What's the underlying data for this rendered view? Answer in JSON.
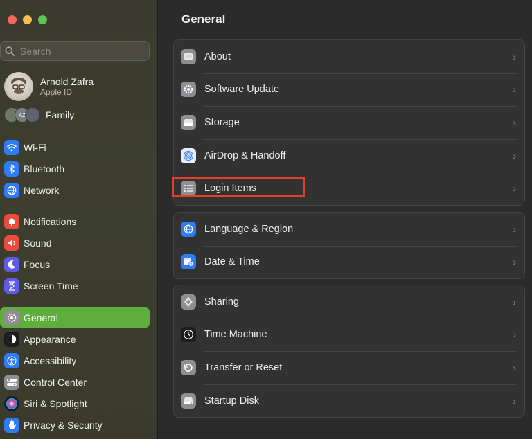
{
  "sidebar": {
    "search_placeholder": "Search",
    "profile": {
      "name": "Arnold Zafra",
      "subtitle": "Apple ID"
    },
    "family": {
      "label": "Family",
      "avatar_initials": "AZ"
    },
    "items": [
      {
        "label": "Wi-Fi",
        "icon": "wifi-icon",
        "color": "#2f7cf6"
      },
      {
        "label": "Bluetooth",
        "icon": "bluetooth-icon",
        "color": "#2f7cf6"
      },
      {
        "label": "Network",
        "icon": "globe-icon",
        "color": "#2f7cf6"
      },
      {
        "label": "Notifications",
        "icon": "bell-icon",
        "color": "#eb4d3d"
      },
      {
        "label": "Sound",
        "icon": "speaker-icon",
        "color": "#eb4d3d"
      },
      {
        "label": "Focus",
        "icon": "moon-icon",
        "color": "#5e5ce6"
      },
      {
        "label": "Screen Time",
        "icon": "hourglass-icon",
        "color": "#5e5ce6"
      },
      {
        "label": "General",
        "icon": "gear-icon",
        "color": "#8e8e93",
        "active": true
      },
      {
        "label": "Appearance",
        "icon": "appearance-icon",
        "color": "#1c1c1e"
      },
      {
        "label": "Accessibility",
        "icon": "accessibility-icon",
        "color": "#2f7cf6"
      },
      {
        "label": "Control Center",
        "icon": "toggles-icon",
        "color": "#8e8e93"
      },
      {
        "label": "Siri & Spotlight",
        "icon": "siri-icon",
        "color": "#1c1c1e"
      },
      {
        "label": "Privacy & Security",
        "icon": "hand-icon",
        "color": "#2f7cf6"
      }
    ]
  },
  "main": {
    "title": "General",
    "groups": [
      [
        {
          "label": "About",
          "icon": "laptop-icon",
          "color": "#8e8e93"
        },
        {
          "label": "Software Update",
          "icon": "gear-badge-icon",
          "color": "#8e8e93"
        },
        {
          "label": "Storage",
          "icon": "drive-icon",
          "color": "#8e8e93"
        },
        {
          "label": "AirDrop & Handoff",
          "icon": "airdrop-icon",
          "color": "#e8eef8"
        },
        {
          "label": "Login Items",
          "icon": "list-icon",
          "color": "#8e8e93"
        }
      ],
      [
        {
          "label": "Language & Region",
          "icon": "globe-icon",
          "color": "#2f7cf6"
        },
        {
          "label": "Date & Time",
          "icon": "calendar-clock-icon",
          "color": "#2f7cf6"
        }
      ],
      [
        {
          "label": "Sharing",
          "icon": "sharing-icon",
          "color": "#8e8e93"
        },
        {
          "label": "Time Machine",
          "icon": "time-machine-icon",
          "color": "#1c1c1e"
        },
        {
          "label": "Transfer or Reset",
          "icon": "reset-icon",
          "color": "#8e8e93"
        },
        {
          "label": "Startup Disk",
          "icon": "disk-icon",
          "color": "#8e8e93"
        }
      ]
    ],
    "highlight_label": "Login Items",
    "chevron": "›"
  }
}
